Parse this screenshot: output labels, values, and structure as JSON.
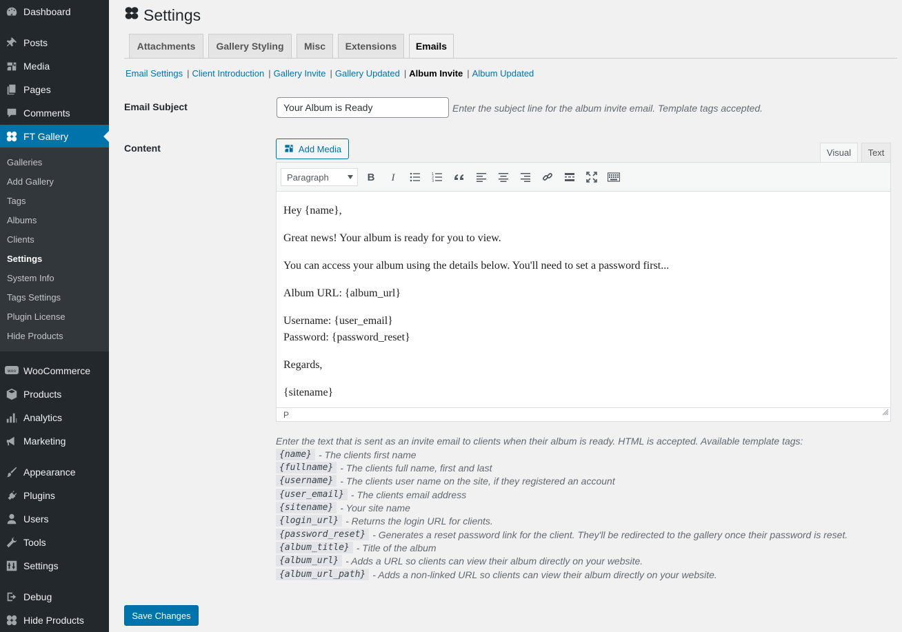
{
  "sidebar": {
    "top_items": [
      {
        "label": "Dashboard",
        "icon": "dashboard-icon"
      },
      {
        "label": "Posts",
        "icon": "pin-icon"
      },
      {
        "label": "Media",
        "icon": "media-icon"
      },
      {
        "label": "Pages",
        "icon": "pages-icon"
      },
      {
        "label": "Comments",
        "icon": "comment-icon"
      },
      {
        "label": "FT Gallery",
        "icon": "gallery-icon"
      }
    ],
    "submenu": [
      "Galleries",
      "Add Gallery",
      "Tags",
      "Albums",
      "Clients",
      "Settings",
      "System Info",
      "Tags Settings",
      "Plugin License",
      "Hide Products"
    ],
    "submenu_current": "Settings",
    "bottom_items": [
      {
        "label": "WooCommerce",
        "icon": "woo-icon"
      },
      {
        "label": "Products",
        "icon": "box-icon"
      },
      {
        "label": "Analytics",
        "icon": "bar-chart-icon"
      },
      {
        "label": "Marketing",
        "icon": "megaphone-icon"
      },
      {
        "label": "Appearance",
        "icon": "brush-icon"
      },
      {
        "label": "Plugins",
        "icon": "plug-icon"
      },
      {
        "label": "Users",
        "icon": "user-icon"
      },
      {
        "label": "Tools",
        "icon": "wrench-icon"
      },
      {
        "label": "Settings",
        "icon": "sliders-icon"
      },
      {
        "label": "Debug",
        "icon": "logout-icon"
      },
      {
        "label": "Hide Products",
        "icon": "gallery-icon"
      }
    ]
  },
  "page": {
    "title": "Settings"
  },
  "tabs": [
    "Attachments",
    "Gallery Styling",
    "Misc",
    "Extensions",
    "Emails"
  ],
  "active_tab": "Emails",
  "sublinks": [
    "Email Settings",
    "Client Introduction",
    "Gallery Invite",
    "Gallery Updated",
    "Album Invite",
    "Album Updated"
  ],
  "current_sublink": "Album Invite",
  "subject": {
    "label": "Email Subject",
    "value": "Your Album is Ready",
    "description": "Enter the subject line for the album invite email. Template tags accepted."
  },
  "content": {
    "label": "Content",
    "add_media": "Add Media",
    "mode_tabs": {
      "visual": "Visual",
      "text": "Text"
    },
    "format": "Paragraph",
    "paragraphs": [
      "Hey {name},",
      "Great news! Your album is ready for you to view.",
      "You can access your album using the details below. You'll need to set a password first...",
      "Album URL: {album_url}",
      "Username: {user_email}",
      "Password: {password_reset}",
      "Regards,",
      "{sitename}"
    ],
    "status_path": "P"
  },
  "help": {
    "intro": "Enter the text that is sent as an invite email to clients when their album is ready. HTML is accepted. Available template tags:",
    "tags": [
      {
        "tag": "{name}",
        "desc": "- The clients first name"
      },
      {
        "tag": "{fullname}",
        "desc": "- The clients full name, first and last"
      },
      {
        "tag": "{username}",
        "desc": "- The clients user name on the site, if they registered an account"
      },
      {
        "tag": "{user_email}",
        "desc": "- The clients email address"
      },
      {
        "tag": "{sitename}",
        "desc": "- Your site name"
      },
      {
        "tag": "{login_url}",
        "desc": "- Returns the login URL for clients."
      },
      {
        "tag": "{password_reset}",
        "desc": "- Generates a reset password link for the client. They'll be redirected to the gallery once their password is reset."
      },
      {
        "tag": "{album_title}",
        "desc": "- Title of the album"
      },
      {
        "tag": "{album_url}",
        "desc": "- Adds a URL so clients can view their album directly on your website."
      },
      {
        "tag": "{album_url_path}",
        "desc": "- Adds a non-linked URL so clients can view their album directly on your website."
      }
    ]
  },
  "save_label": "Save Changes",
  "colors": {
    "sidebar_bg": "#23282d",
    "submenu_bg": "#32373c",
    "accent": "#0073aa",
    "page_bg": "#f1f1f1"
  }
}
